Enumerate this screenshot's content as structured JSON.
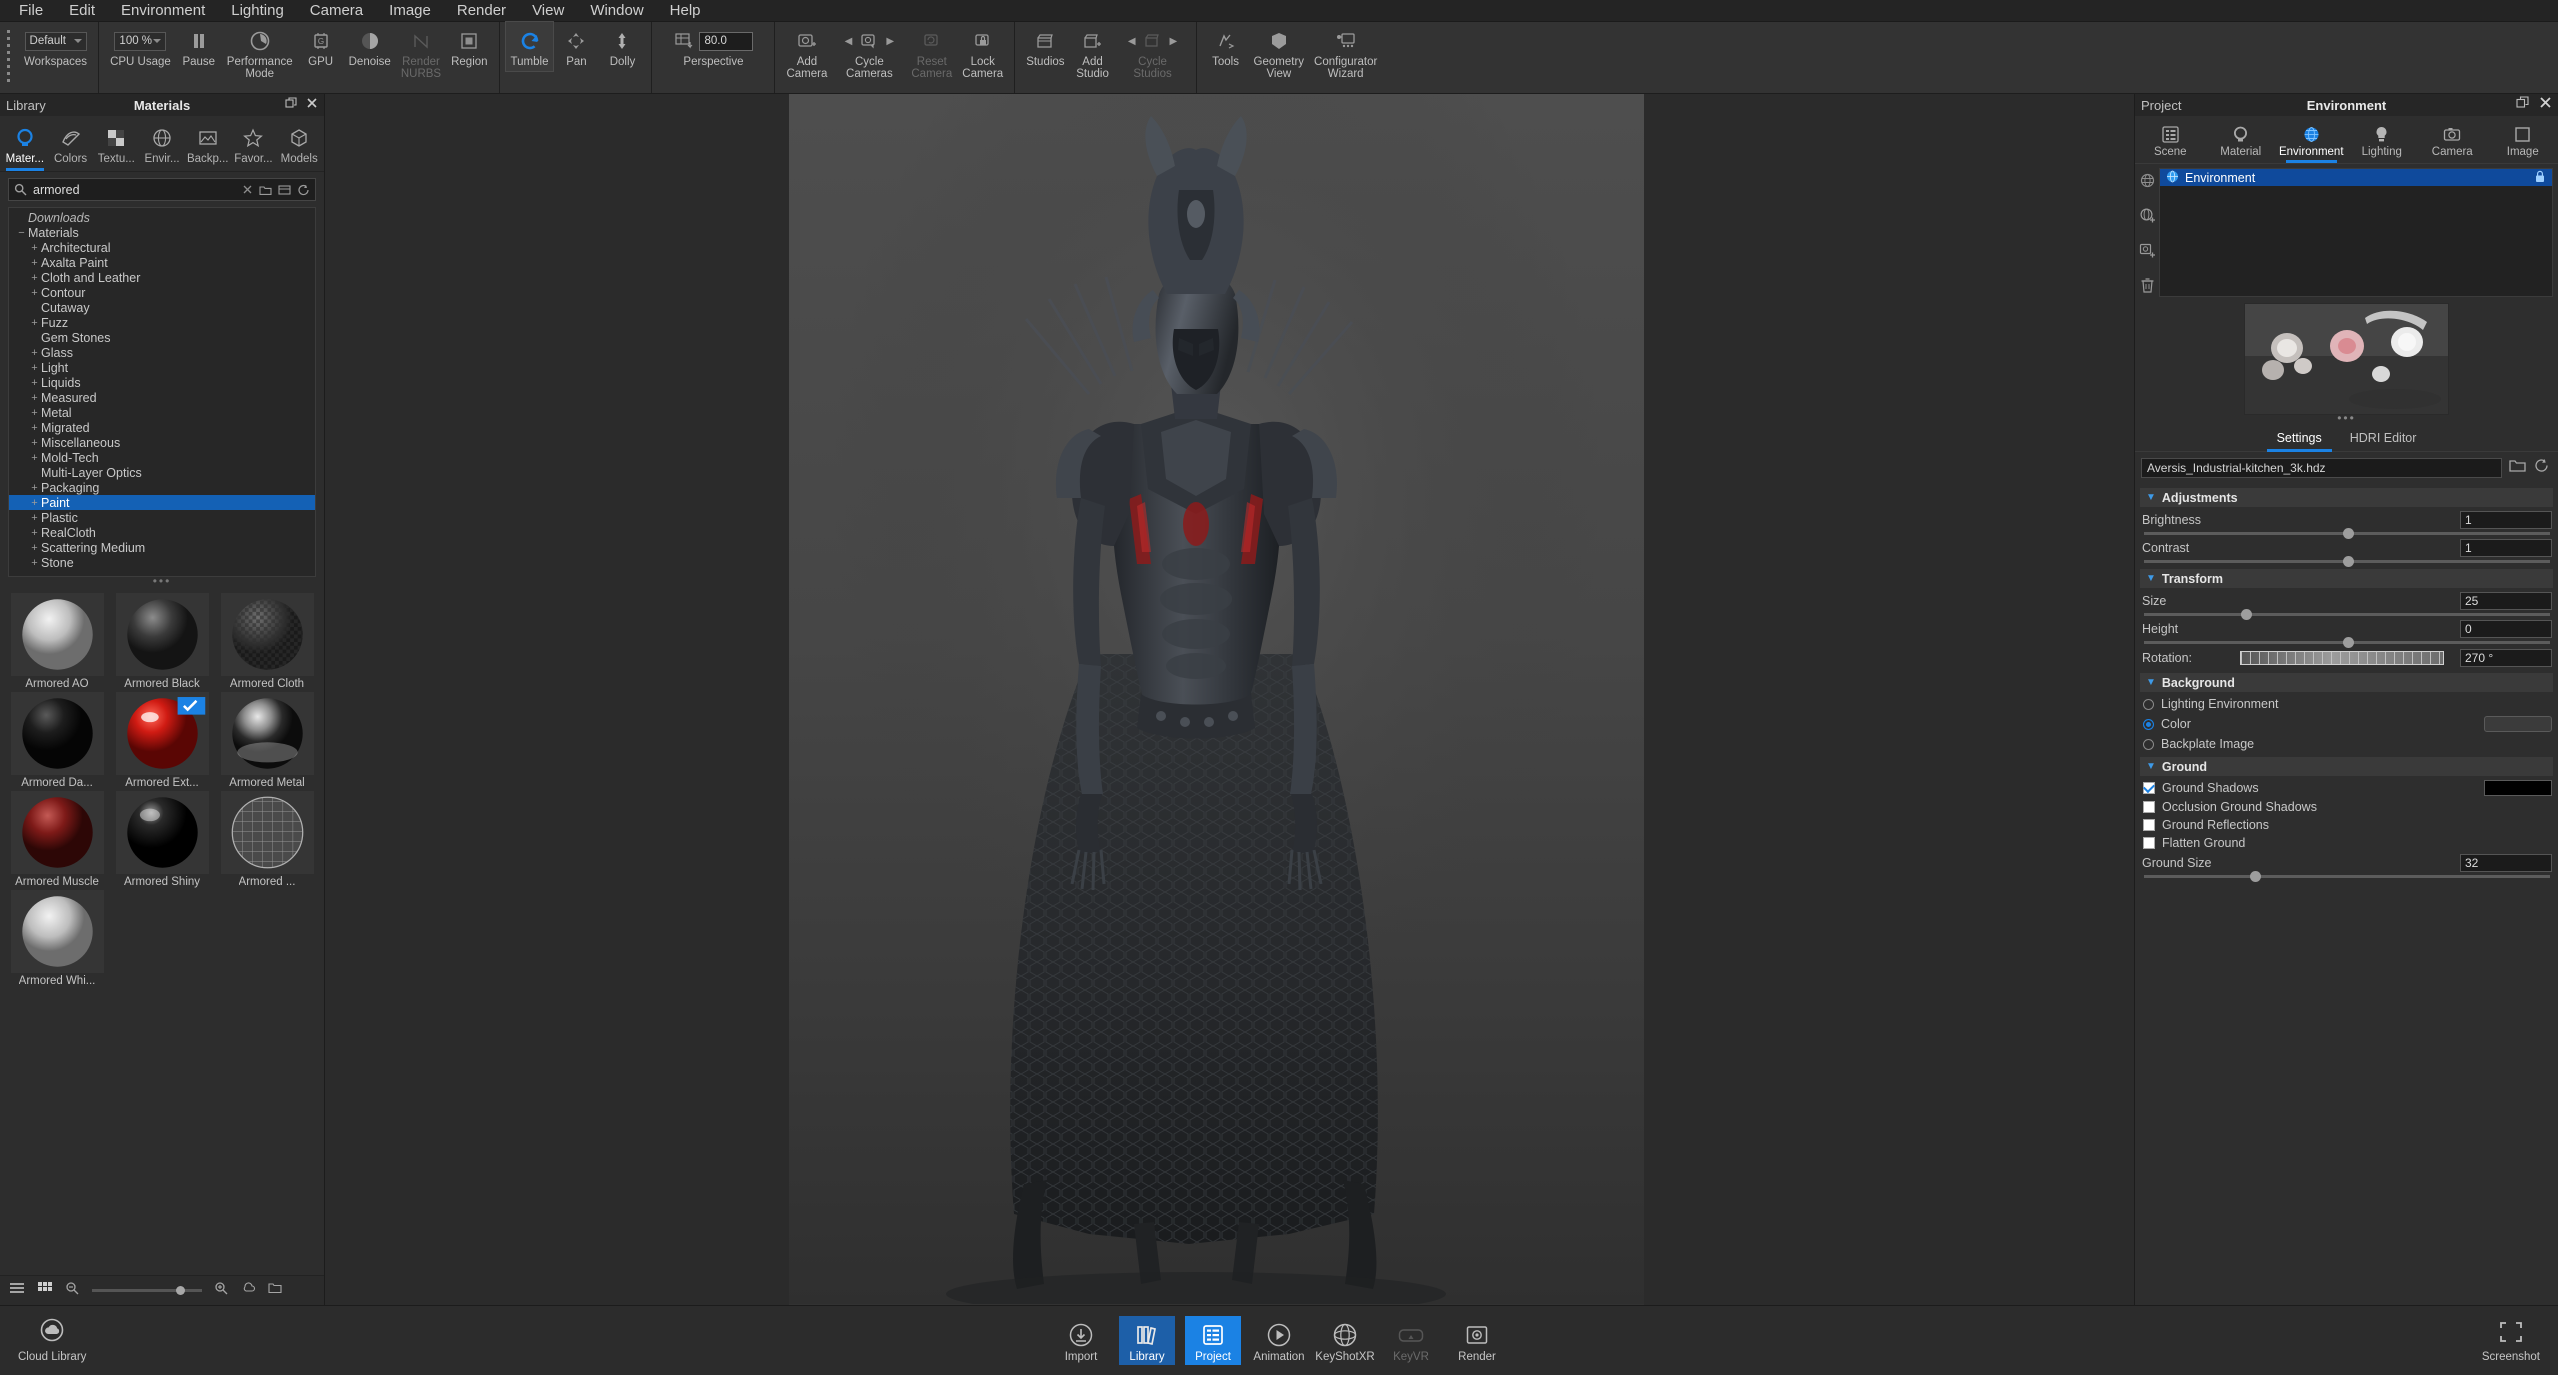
{
  "menubar": {
    "items": [
      "File",
      "Edit",
      "Environment",
      "Lighting",
      "Camera",
      "Image",
      "Render",
      "View",
      "Window",
      "Help"
    ]
  },
  "toolbar": {
    "workspaces": {
      "value": "Default",
      "label": "Workspaces"
    },
    "cpu_usage": {
      "value": "100 %",
      "label": "CPU Usage"
    },
    "pause": {
      "label": "Pause"
    },
    "performance_mode": {
      "label": "Performance\nMode"
    },
    "gpu": {
      "label": "GPU"
    },
    "denoise": {
      "label": "Denoise"
    },
    "render_nurbs": {
      "label": "Render\nNURBS"
    },
    "region": {
      "label": "Region"
    },
    "tumble": {
      "label": "Tumble"
    },
    "pan": {
      "label": "Pan"
    },
    "dolly": {
      "label": "Dolly"
    },
    "perspective": {
      "label": "Perspective",
      "value": "80.0"
    },
    "add_camera": {
      "label": "Add\nCamera"
    },
    "cycle_cameras": {
      "label": "Cycle\nCameras"
    },
    "reset_camera": {
      "label": "Reset\nCamera"
    },
    "lock_camera": {
      "label": "Lock\nCamera"
    },
    "studios": {
      "label": "Studios"
    },
    "add_studio": {
      "label": "Add\nStudio"
    },
    "cycle_studios": {
      "label": "Cycle\nStudios"
    },
    "tools": {
      "label": "Tools"
    },
    "geometry_view": {
      "label": "Geometry\nView"
    },
    "configurator_wizard": {
      "label": "Configurator\nWizard"
    }
  },
  "library": {
    "panel_left_label": "Library",
    "panel_title": "Materials",
    "tabs": [
      {
        "label": "Mater...",
        "icon": "material-icon",
        "selected": true
      },
      {
        "label": "Colors",
        "icon": "colors-icon",
        "selected": false
      },
      {
        "label": "Textu...",
        "icon": "texture-icon",
        "selected": false
      },
      {
        "label": "Envir...",
        "icon": "environment-icon",
        "selected": false
      },
      {
        "label": "Backp...",
        "icon": "backplate-icon",
        "selected": false
      },
      {
        "label": "Favor...",
        "icon": "favorites-icon",
        "selected": false
      },
      {
        "label": "Models",
        "icon": "models-icon",
        "selected": false
      }
    ],
    "search": {
      "value": "armored",
      "placeholder": "Search"
    },
    "tree": [
      {
        "label": "Downloads",
        "indent": 1,
        "expander": "",
        "italic": true,
        "selected": false
      },
      {
        "label": "Materials",
        "indent": 1,
        "expander": "−",
        "italic": false,
        "selected": false
      },
      {
        "label": "Architectural",
        "indent": 2,
        "expander": "+",
        "italic": false,
        "selected": false
      },
      {
        "label": "Axalta Paint",
        "indent": 2,
        "expander": "+",
        "italic": false,
        "selected": false
      },
      {
        "label": "Cloth and Leather",
        "indent": 2,
        "expander": "+",
        "italic": false,
        "selected": false
      },
      {
        "label": "Contour",
        "indent": 2,
        "expander": "+",
        "italic": false,
        "selected": false
      },
      {
        "label": "Cutaway",
        "indent": 2,
        "expander": "",
        "italic": false,
        "selected": false
      },
      {
        "label": "Fuzz",
        "indent": 2,
        "expander": "+",
        "italic": false,
        "selected": false
      },
      {
        "label": "Gem Stones",
        "indent": 2,
        "expander": "",
        "italic": false,
        "selected": false
      },
      {
        "label": "Glass",
        "indent": 2,
        "expander": "+",
        "italic": false,
        "selected": false
      },
      {
        "label": "Light",
        "indent": 2,
        "expander": "+",
        "italic": false,
        "selected": false
      },
      {
        "label": "Liquids",
        "indent": 2,
        "expander": "+",
        "italic": false,
        "selected": false
      },
      {
        "label": "Measured",
        "indent": 2,
        "expander": "+",
        "italic": false,
        "selected": false
      },
      {
        "label": "Metal",
        "indent": 2,
        "expander": "+",
        "italic": false,
        "selected": false
      },
      {
        "label": "Migrated",
        "indent": 2,
        "expander": "+",
        "italic": false,
        "selected": false
      },
      {
        "label": "Miscellaneous",
        "indent": 2,
        "expander": "+",
        "italic": false,
        "selected": false
      },
      {
        "label": "Mold-Tech",
        "indent": 2,
        "expander": "+",
        "italic": false,
        "selected": false
      },
      {
        "label": "Multi-Layer Optics",
        "indent": 2,
        "expander": "",
        "italic": false,
        "selected": false
      },
      {
        "label": "Packaging",
        "indent": 2,
        "expander": "+",
        "italic": false,
        "selected": false
      },
      {
        "label": "Paint",
        "indent": 2,
        "expander": "+",
        "italic": false,
        "selected": true
      },
      {
        "label": "Plastic",
        "indent": 2,
        "expander": "+",
        "italic": false,
        "selected": false
      },
      {
        "label": "RealCloth",
        "indent": 2,
        "expander": "+",
        "italic": false,
        "selected": false
      },
      {
        "label": "Scattering Medium",
        "indent": 2,
        "expander": "+",
        "italic": false,
        "selected": false
      },
      {
        "label": "Stone",
        "indent": 2,
        "expander": "+",
        "italic": false,
        "selected": false
      }
    ],
    "materials": [
      {
        "name": "Armored AO",
        "kind": "sphere-light-gray"
      },
      {
        "name": "Armored Black",
        "kind": "sphere-dark"
      },
      {
        "name": "Armored Cloth",
        "kind": "sphere-texture-dark"
      },
      {
        "name": "Armored Da...",
        "kind": "sphere-black"
      },
      {
        "name": "Armored Ext...",
        "kind": "sphere-red-badge"
      },
      {
        "name": "Armored Metal",
        "kind": "sphere-metal"
      },
      {
        "name": "Armored Muscle",
        "kind": "sphere-darkred"
      },
      {
        "name": "Armored Shiny",
        "kind": "sphere-shiny-black"
      },
      {
        "name": "Armored ...",
        "kind": "sphere-wire"
      },
      {
        "name": "Armored Whi...",
        "kind": "sphere-light-gray"
      }
    ],
    "footer": {
      "zoom_label": ""
    }
  },
  "project": {
    "panel_left_label": "Project",
    "panel_title": "Environment",
    "tabs": [
      {
        "label": "Scene",
        "icon": "scene-icon",
        "selected": false
      },
      {
        "label": "Material",
        "icon": "material-icon",
        "selected": false
      },
      {
        "label": "Environment",
        "icon": "environment-globe-icon",
        "selected": true
      },
      {
        "label": "Lighting",
        "icon": "lighting-bulb-icon",
        "selected": false
      },
      {
        "label": "Camera",
        "icon": "camera-icon",
        "selected": false
      },
      {
        "label": "Image",
        "icon": "image-icon",
        "selected": false
      }
    ],
    "env_list": [
      {
        "name": "Environment",
        "selected": true
      }
    ],
    "settings_tabs": [
      {
        "label": "Settings",
        "selected": true
      },
      {
        "label": "HDRI Editor",
        "selected": false
      }
    ],
    "hdri_file": "Aversis_Industrial-kitchen_3k.hdz",
    "sections": {
      "adjustments": {
        "title": "Adjustments",
        "rows": [
          {
            "label": "Brightness",
            "value": "1",
            "slider_pct": 50
          },
          {
            "label": "Contrast",
            "value": "1",
            "slider_pct": 50
          }
        ]
      },
      "transform": {
        "title": "Transform",
        "rows": [
          {
            "label": "Size",
            "value": "25",
            "slider_pct": 25
          },
          {
            "label": "Height",
            "value": "0",
            "slider_pct": 50
          }
        ],
        "rotation": {
          "label": "Rotation:",
          "value": "270 °"
        }
      },
      "background": {
        "title": "Background",
        "options": [
          {
            "label": "Lighting Environment",
            "selected": false,
            "has_color": false
          },
          {
            "label": "Color",
            "selected": true,
            "has_color": true,
            "color": "#3b3b3b"
          },
          {
            "label": "Backplate Image",
            "selected": false,
            "has_color": false
          }
        ]
      },
      "ground": {
        "title": "Ground",
        "checks": [
          {
            "label": "Ground Shadows",
            "checked": true,
            "has_color": true,
            "color": "#000000"
          },
          {
            "label": "Occlusion Ground Shadows",
            "checked": false,
            "has_color": false
          },
          {
            "label": "Ground Reflections",
            "checked": false,
            "has_color": false
          },
          {
            "label": "Flatten Ground",
            "checked": false,
            "has_color": false
          }
        ],
        "ground_size": {
          "label": "Ground Size",
          "value": "32",
          "slider_pct": 27
        }
      }
    }
  },
  "bottombar": {
    "cloud_library": "Cloud Library",
    "items": [
      {
        "label": "Import",
        "icon": "import-icon",
        "state": "normal"
      },
      {
        "label": "Library",
        "icon": "library-icon",
        "state": "selected"
      },
      {
        "label": "Project",
        "icon": "project-icon",
        "state": "selected-bright"
      },
      {
        "label": "Animation",
        "icon": "animation-icon",
        "state": "normal"
      },
      {
        "label": "KeyShotXR",
        "icon": "keyshotxr-icon",
        "state": "normal"
      },
      {
        "label": "KeyVR",
        "icon": "keyvr-icon",
        "state": "disabled"
      },
      {
        "label": "Render",
        "icon": "render-icon",
        "state": "normal"
      }
    ],
    "screenshot": "Screenshot"
  },
  "colors": {
    "accent_blue": "#1b82e4",
    "selection_blue": "#1461b5",
    "panel_bg": "#2d2d2d",
    "toolbar_bg": "#333333",
    "menu_bg": "#242424"
  }
}
